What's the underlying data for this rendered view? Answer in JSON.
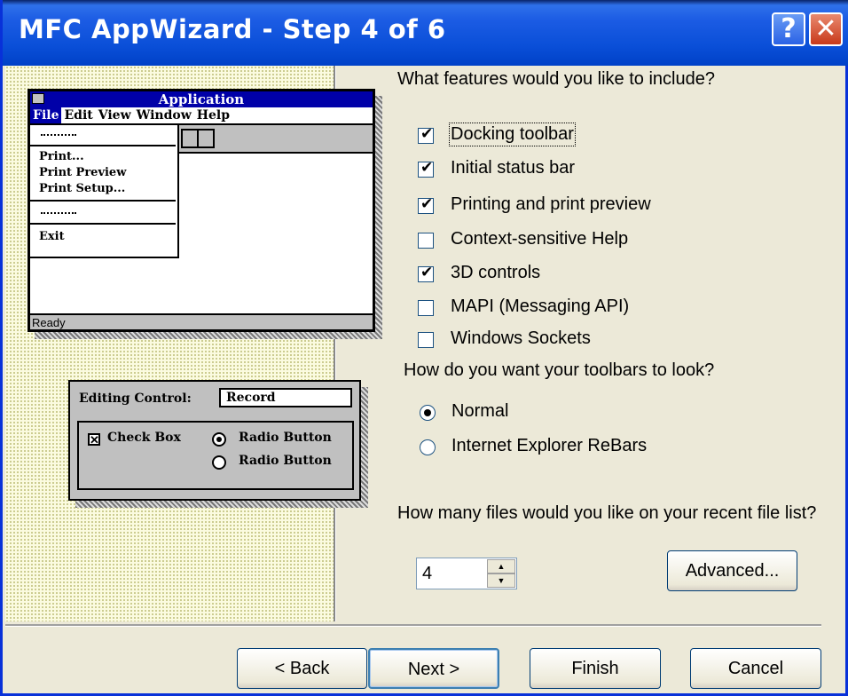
{
  "window": {
    "title": "MFC AppWizard - Step 4 of 6",
    "help_label": "?",
    "close_label": "✕"
  },
  "preview": {
    "app_title": "Application",
    "menu": [
      "File",
      "Edit",
      "View",
      "Window",
      "Help"
    ],
    "file_menu_items": [
      "Print...",
      "Print Preview",
      "Print Setup...",
      "Exit"
    ],
    "status": "Ready",
    "editing_control_label": "Editing Control:",
    "editing_control_value": "Record",
    "check_box_label": "Check Box",
    "check_box_mark": "✕",
    "radio_label_1": "Radio Button",
    "radio_label_2": "Radio Button"
  },
  "features": {
    "question": "What features would you like to include?",
    "options": [
      {
        "label": "Docking toolbar",
        "checked": true
      },
      {
        "label": "Initial status bar",
        "checked": true
      },
      {
        "label": "Printing and print preview",
        "checked": true
      },
      {
        "label": "Context-sensitive Help",
        "checked": false
      },
      {
        "label": "3D controls",
        "checked": true
      },
      {
        "label": "MAPI (Messaging API)",
        "checked": false
      },
      {
        "label": "Windows Sockets",
        "checked": false
      }
    ],
    "check_mark": "✔"
  },
  "toolbars": {
    "question": "How do you want your toolbars to look?",
    "options": [
      {
        "label": "Normal",
        "selected": true
      },
      {
        "label": "Internet Explorer ReBars",
        "selected": false
      }
    ]
  },
  "recent_files": {
    "question": "How many files would you like on your recent file list?",
    "value": "4",
    "up_arrow": "▲",
    "down_arrow": "▼"
  },
  "buttons": {
    "advanced": "Advanced...",
    "back": "< Back",
    "next": "Next >",
    "finish": "Finish",
    "cancel": "Cancel"
  }
}
